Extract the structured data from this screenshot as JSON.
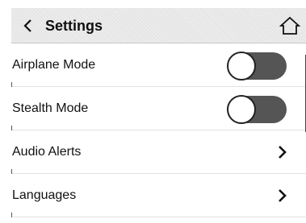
{
  "header": {
    "title": "Settings",
    "back_icon": "chevron-left-icon",
    "home_icon": "home-icon"
  },
  "settings": [
    {
      "label": "Airplane Mode",
      "type": "toggle",
      "enabled": false
    },
    {
      "label": "Stealth Mode",
      "type": "toggle",
      "enabled": false
    },
    {
      "label": "Audio Alerts",
      "type": "link"
    },
    {
      "label": "Languages",
      "type": "link"
    }
  ],
  "colors": {
    "toggle_track": "#555555",
    "header_bg": "#ececec"
  }
}
